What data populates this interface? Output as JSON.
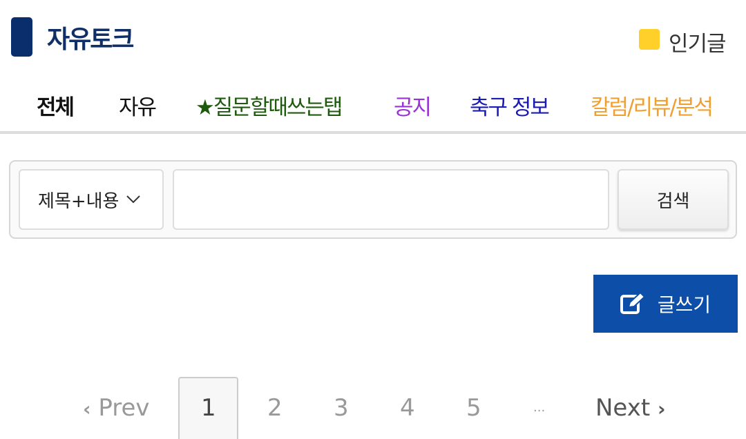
{
  "header": {
    "title": "자유토크",
    "popular_label": "인기글",
    "colors": {
      "title_bar": "#0a2d6b",
      "popular": "#ffd02a"
    }
  },
  "tabs": [
    {
      "label": "전체",
      "color": "#111111",
      "active": true
    },
    {
      "label": "자유",
      "color": "#111111"
    },
    {
      "label": "★질문할때쓰는탭",
      "color": "#1e5a0e"
    },
    {
      "label": "공지",
      "color": "#9b30d9"
    },
    {
      "label": "축구 정보",
      "color": "#1a1ab4"
    },
    {
      "label": "칼럼/리뷰/분석",
      "color": "#f0a030"
    }
  ],
  "search": {
    "scope": "제목+내용",
    "value": "",
    "button": "검색"
  },
  "write_button": {
    "label": "글쓰기",
    "icon": "edit-icon",
    "color": "#0d4fa8"
  },
  "pagination": {
    "prev": "Prev",
    "pages": [
      "1",
      "2",
      "3",
      "4",
      "5"
    ],
    "current": "1",
    "ellipsis": "...",
    "next": "Next"
  }
}
